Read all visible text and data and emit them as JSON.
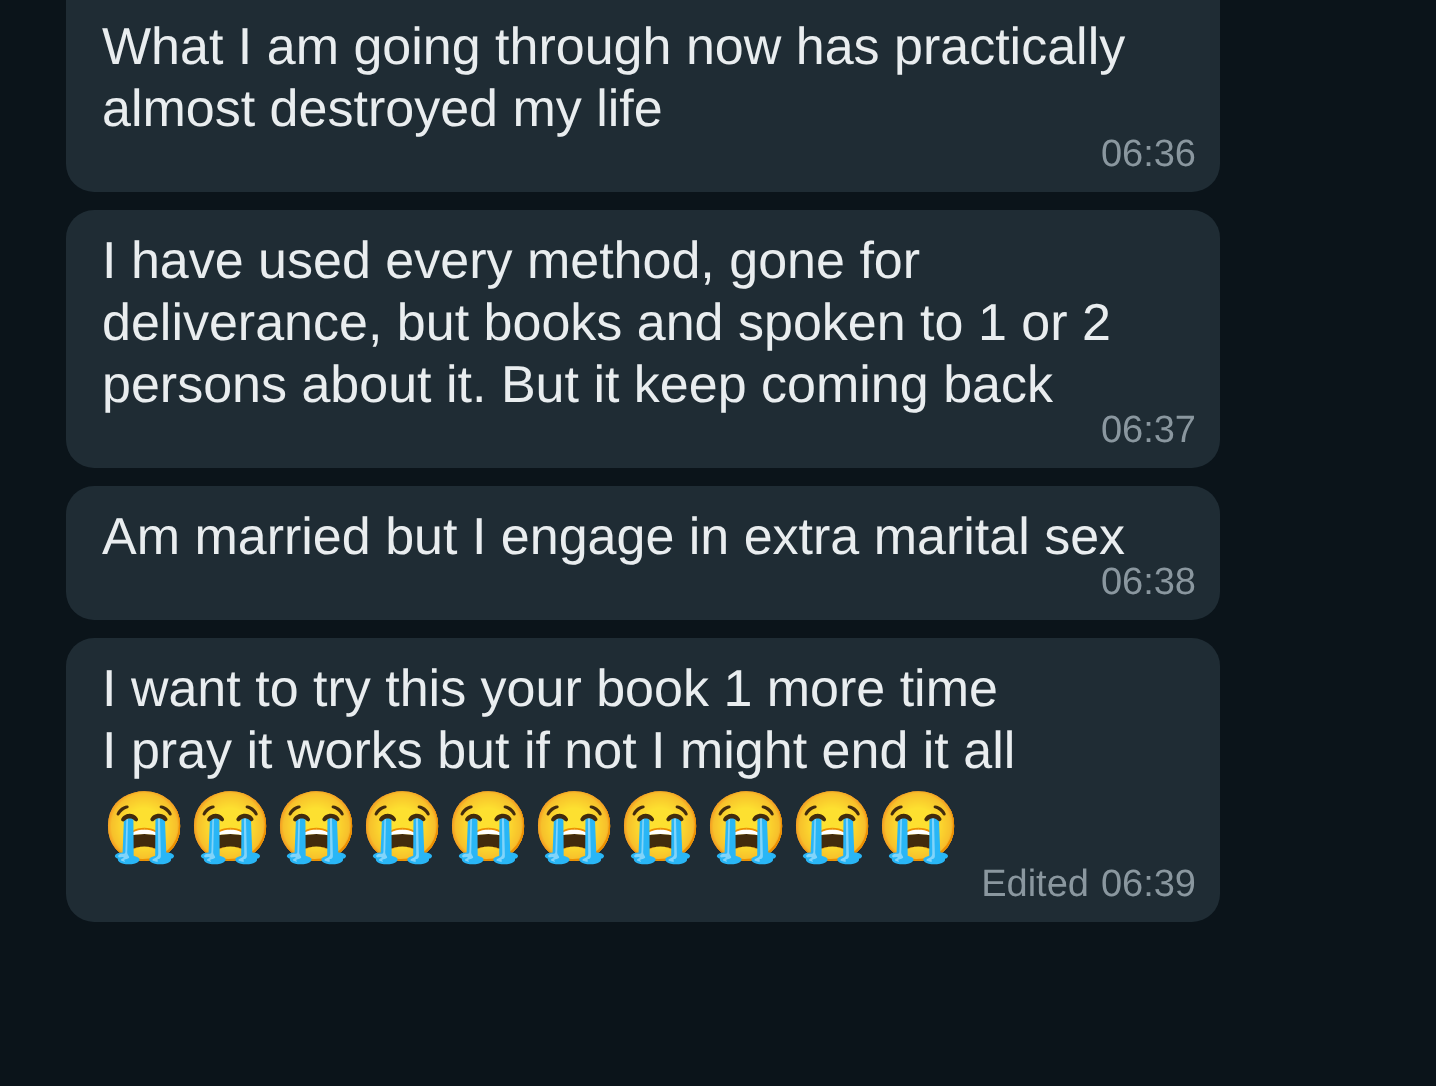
{
  "messages": [
    {
      "text": "What I am going through now has practically almost destroyed my life",
      "time": "06:36"
    },
    {
      "text": "I have used every method, gone for deliverance, but books and spoken to 1 or 2 persons about it. But it keep coming back",
      "time": "06:37"
    },
    {
      "text": "Am married but I engage in extra marital sex",
      "time": "06:38"
    },
    {
      "text": "I want to try this your book 1 more time\nI pray it works but if not I might end it all",
      "emoji": "😭😭😭😭😭😭😭😭😭😭",
      "time": "06:39",
      "edited_label": "Edited"
    }
  ]
}
